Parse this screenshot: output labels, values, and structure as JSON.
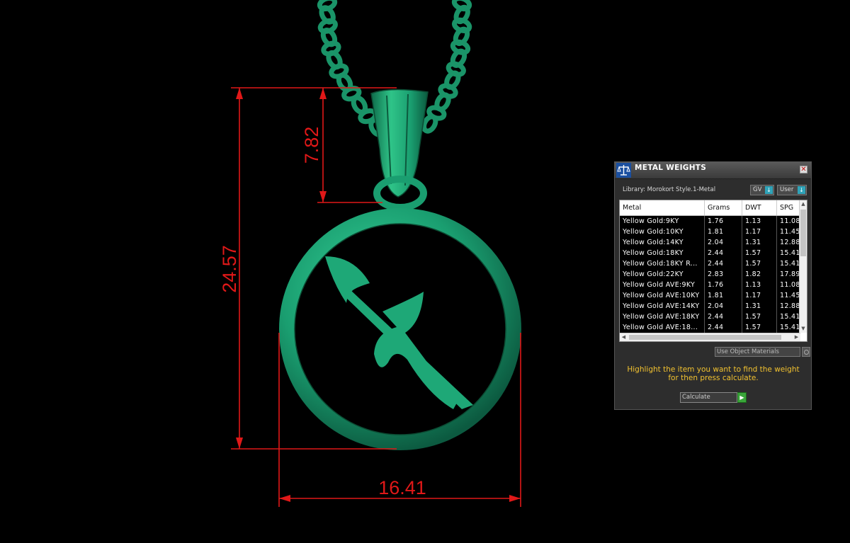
{
  "dimensions": {
    "height_total": "24.57",
    "bail_height": "7.82",
    "width": "16.41"
  },
  "colors": {
    "dimension_lines": "#e01818",
    "model": "#1a9e70",
    "panel_bg": "#2d2d2d",
    "instruction_text": "#f2c230",
    "calculate_button": "#3aa63a"
  },
  "panel": {
    "title": "METAL WEIGHTS",
    "close_symbol": "✕",
    "library_label": "Library: Morokort Style.1-Metal",
    "unit_dropdown": "GV",
    "user_dropdown": "User",
    "columns": [
      "Metal",
      "Grams",
      "DWT",
      "SPG"
    ],
    "rows": [
      [
        "Yellow Gold:9KY",
        "1.76",
        "1.13",
        "11.08"
      ],
      [
        "Yellow Gold:10KY",
        "1.81",
        "1.17",
        "11.45"
      ],
      [
        "Yellow Gold:14KY",
        "2.04",
        "1.31",
        "12.88"
      ],
      [
        "Yellow Gold:18KY",
        "2.44",
        "1.57",
        "15.41"
      ],
      [
        "Yellow Gold:18KY R...",
        "2.44",
        "1.57",
        "15.41"
      ],
      [
        "Yellow Gold:22KY",
        "2.83",
        "1.82",
        "17.89"
      ],
      [
        "Yellow Gold AVE:9KY",
        "1.76",
        "1.13",
        "11.08"
      ],
      [
        "Yellow Gold AVE:10KY",
        "1.81",
        "1.17",
        "11.45"
      ],
      [
        "Yellow Gold AVE:14KY",
        "2.04",
        "1.31",
        "12.88"
      ],
      [
        "Yellow Gold AVE:18KY",
        "2.44",
        "1.57",
        "15.41"
      ],
      [
        "Yellow Gold AVE:18...",
        "2.44",
        "1.57",
        "15.41"
      ]
    ],
    "use_object_materials": "Use Object Materials",
    "instructions": "Highlight the item you want to find the weight for then press calculate.",
    "calculate_label": "Calculate"
  }
}
